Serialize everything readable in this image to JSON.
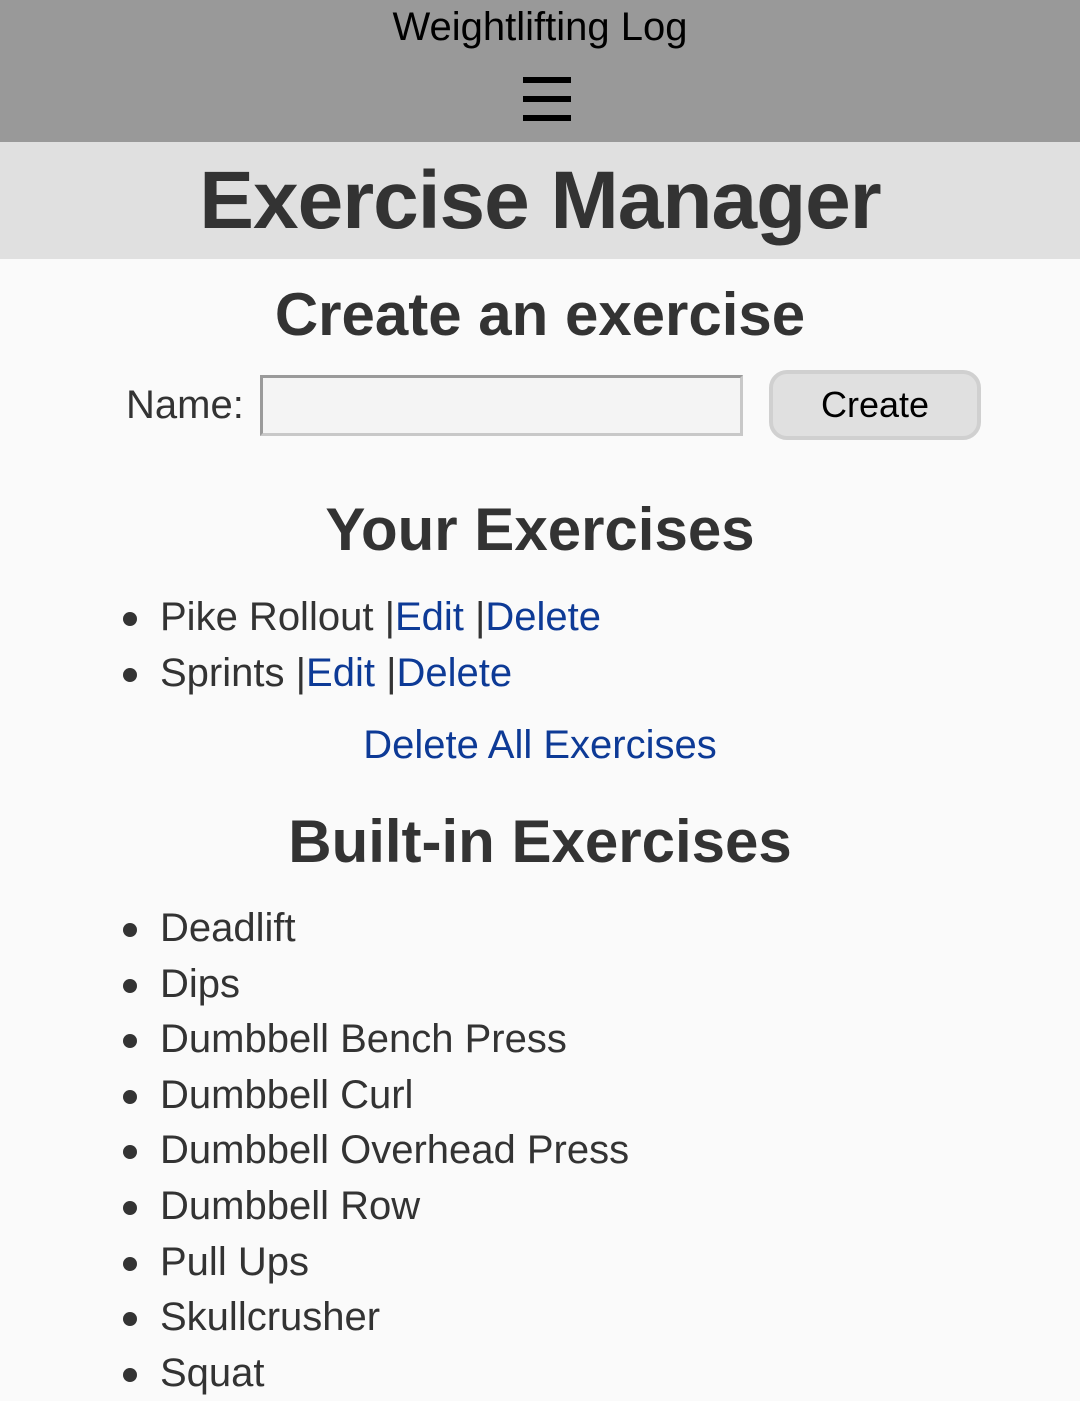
{
  "app": {
    "title": "Weightlifting Log",
    "menu_icon": "hamburger-menu-icon"
  },
  "page": {
    "title": "Exercise Manager"
  },
  "create_section": {
    "heading": "Create an exercise",
    "name_label": "Name:",
    "name_value": "",
    "name_placeholder": "",
    "create_button": "Create"
  },
  "your_exercises": {
    "heading": "Your Exercises",
    "separator": "|",
    "items": [
      {
        "name": "Pike Rollout",
        "edit_label": "Edit",
        "delete_label": "Delete"
      },
      {
        "name": "Sprints",
        "edit_label": "Edit",
        "delete_label": "Delete"
      }
    ],
    "delete_all_label": "Delete All Exercises"
  },
  "builtin_exercises": {
    "heading": "Built-in Exercises",
    "items": [
      "Deadlift",
      "Dips",
      "Dumbbell Bench Press",
      "Dumbbell Curl",
      "Dumbbell Overhead Press",
      "Dumbbell Row",
      "Pull Ups",
      "Skullcrusher",
      "Squat"
    ]
  },
  "colors": {
    "topbar": "#999999",
    "header": "#e0e0e0",
    "background": "#fafafa",
    "text": "#333333",
    "link": "#0d3a96"
  }
}
